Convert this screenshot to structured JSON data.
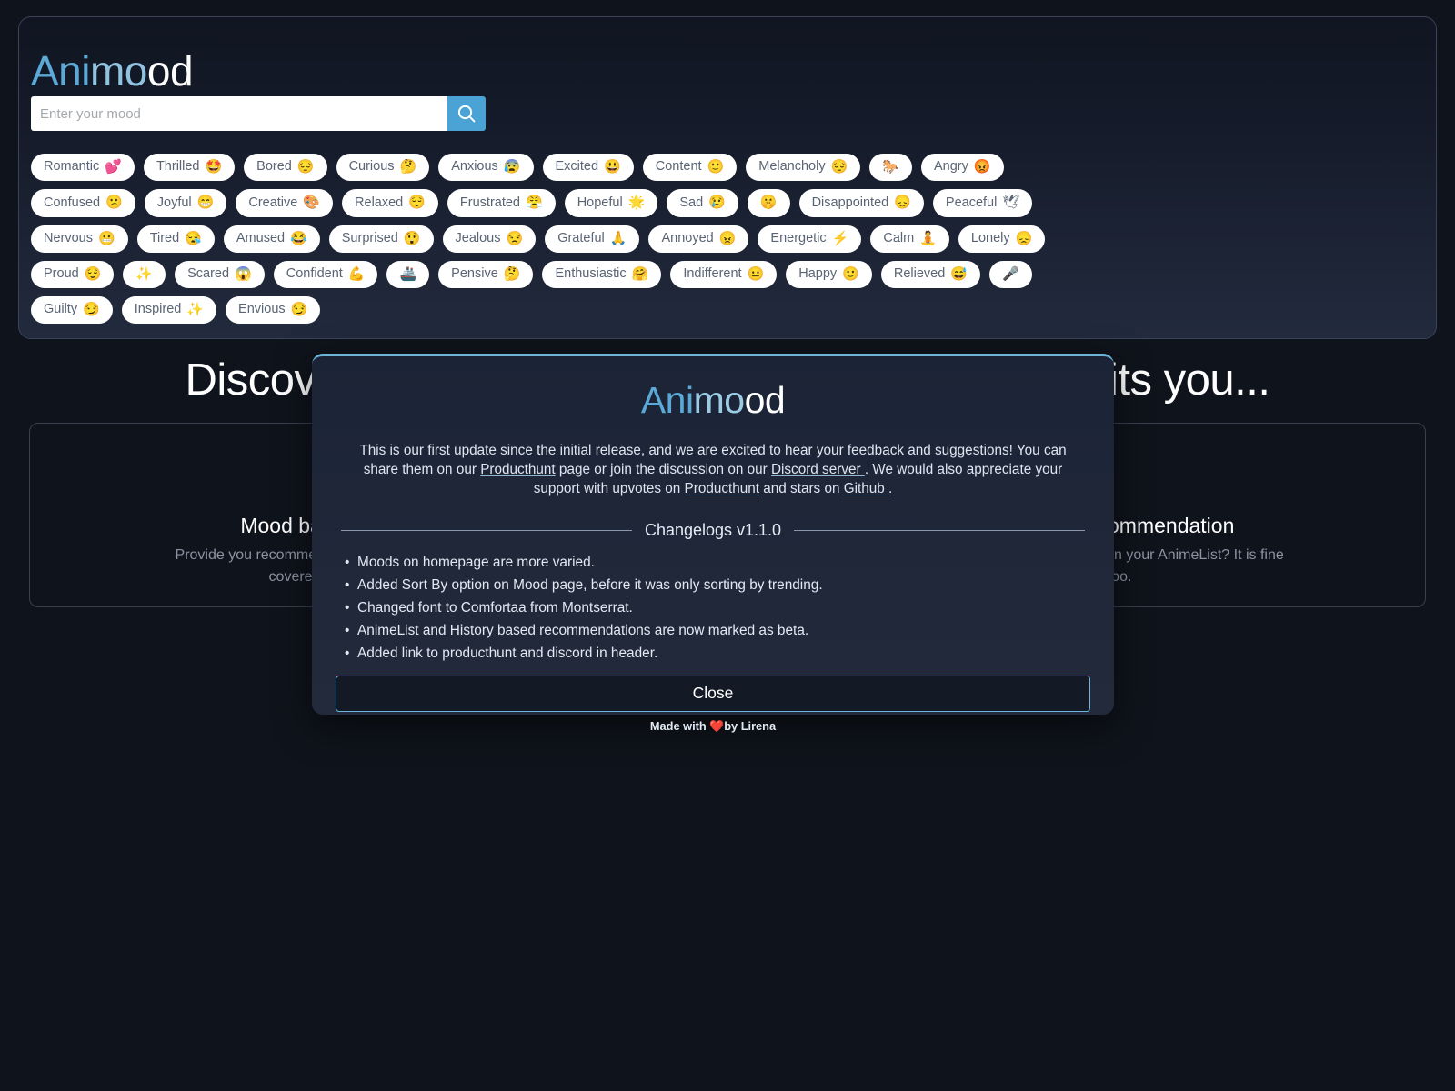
{
  "page": {
    "background_color": "#0f131b",
    "accent_color": "#5aa9d6"
  },
  "header": {
    "brand": {
      "part1": "Ani",
      "part2": "mo",
      "part3": "od"
    },
    "search": {
      "placeholder": "Enter your mood",
      "value": "",
      "button_icon": "search-icon"
    },
    "moods": [
      {
        "label": "Romantic",
        "emoji": "💕"
      },
      {
        "label": "Thrilled",
        "emoji": "🤩"
      },
      {
        "label": "Bored",
        "emoji": "😔"
      },
      {
        "label": "Curious",
        "emoji": "🤔"
      },
      {
        "label": "Anxious",
        "emoji": "😰"
      },
      {
        "label": "Excited",
        "emoji": "😃"
      },
      {
        "label": "Content",
        "emoji": "🙂"
      },
      {
        "label": "Melancholy",
        "emoji": "😔"
      },
      {
        "label": "",
        "emoji": "🐎"
      },
      {
        "label": "Angry",
        "emoji": "😡"
      },
      {
        "label": "Confused",
        "emoji": "😕"
      },
      {
        "label": "Joyful",
        "emoji": "😁"
      },
      {
        "label": "Creative",
        "emoji": "🎨"
      },
      {
        "label": "Relaxed",
        "emoji": "😌"
      },
      {
        "label": "Frustrated",
        "emoji": "😤"
      },
      {
        "label": "Hopeful",
        "emoji": "🌟"
      },
      {
        "label": "Sad",
        "emoji": "😢"
      },
      {
        "label": "",
        "emoji": "🤫"
      },
      {
        "label": "Disappointed",
        "emoji": "😞"
      },
      {
        "label": "Peaceful",
        "emoji": "🕊"
      },
      {
        "label": "Nervous",
        "emoji": "😬"
      },
      {
        "label": "Tired",
        "emoji": "😪"
      },
      {
        "label": "Amused",
        "emoji": "😂"
      },
      {
        "label": "Surprised",
        "emoji": "😲"
      },
      {
        "label": "Jealous",
        "emoji": "😒"
      },
      {
        "label": "Grateful",
        "emoji": "🙏"
      },
      {
        "label": "Annoyed",
        "emoji": "😠"
      },
      {
        "label": "Energetic",
        "emoji": "⚡"
      },
      {
        "label": "Calm",
        "emoji": "🧘"
      },
      {
        "label": "Lonely",
        "emoji": "😞"
      },
      {
        "label": "Proud",
        "emoji": "😌"
      },
      {
        "label": "",
        "emoji": "✨"
      },
      {
        "label": "Scared",
        "emoji": "😱"
      },
      {
        "label": "Confident",
        "emoji": "💪"
      },
      {
        "label": "",
        "emoji": "🚢"
      },
      {
        "label": "Pensive",
        "emoji": "🤔"
      },
      {
        "label": "Enthusiastic",
        "emoji": "🤗"
      },
      {
        "label": "Indifferent",
        "emoji": "😐"
      },
      {
        "label": "Happy",
        "emoji": "🙂"
      },
      {
        "label": "Relieved",
        "emoji": "😅"
      },
      {
        "label": "",
        "emoji": "🎤"
      },
      {
        "label": "Guilty",
        "emoji": "😏"
      },
      {
        "label": "Inspired",
        "emoji": "✨"
      },
      {
        "label": "Envious",
        "emoji": "😏"
      }
    ]
  },
  "main": {
    "hero_title": "Discover anime. Recommendations. Pick what fits you...",
    "cards": [
      {
        "icon": "smiley-face-icon",
        "title": "Mood based recommendation",
        "description": "Provide you recommendation based on your mood. We got you covered for every mood you have."
      },
      {
        "icon": "animelist-logo-icon",
        "title": "AnimeList based recommendation",
        "description": "Want anime recommendation based on your AnimeList? It is fine we have that too."
      }
    ]
  },
  "modal": {
    "brand": {
      "part1": "Ani",
      "part2": "mo",
      "part3": "od"
    },
    "description": {
      "s1": "This is our first update since the initial release, and we are excited to hear your feedback and suggestions! You can share them on our ",
      "link1": "Producthunt",
      "s2": " page or join the discussion on our ",
      "link2": "Discord server ",
      "s3": ". We would also appreciate your support with upvotes on ",
      "link3": "Producthunt",
      "s4": " and stars on ",
      "link4": "Github ",
      "s5": "."
    },
    "changelog_heading": "Changelogs v1.1.0",
    "changelog_items": [
      "Moods on homepage are more varied.",
      "Added Sort By option on Mood page, before it was only sorting by trending.",
      "Changed font to Comfortaa from Montserrat.",
      "AnimeList and History based recommendations are now marked as beta.",
      "Added link to producthunt and discord in header."
    ],
    "close_label": "Close",
    "footer": {
      "prefix": "Made with ",
      "heart": "❤️",
      "suffix": "by Lirena"
    }
  }
}
